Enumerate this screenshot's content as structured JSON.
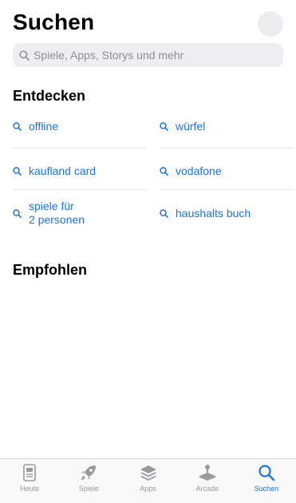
{
  "header": {
    "title": "Suchen"
  },
  "search": {
    "placeholder": "Spiele, Apps, Storys und mehr"
  },
  "discover": {
    "title": "Entdecken",
    "items": [
      {
        "label": "offline"
      },
      {
        "label": "würfel"
      },
      {
        "label": "kaufland card"
      },
      {
        "label": "vodafone"
      },
      {
        "label": "spiele für\n2 personen"
      },
      {
        "label": "haushalts buch"
      }
    ]
  },
  "recommended": {
    "title": "Empfohlen"
  },
  "tabbar": {
    "tabs": [
      {
        "label": "Heute",
        "icon": "today-icon"
      },
      {
        "label": "Spiele",
        "icon": "rocket-icon"
      },
      {
        "label": "Apps",
        "icon": "layers-icon"
      },
      {
        "label": "Arcade",
        "icon": "joystick-icon"
      },
      {
        "label": "Suchen",
        "icon": "search-icon"
      }
    ],
    "active": "Suchen"
  },
  "colors": {
    "accent": "#1a73e8",
    "inactive": "#9a9a9e"
  }
}
